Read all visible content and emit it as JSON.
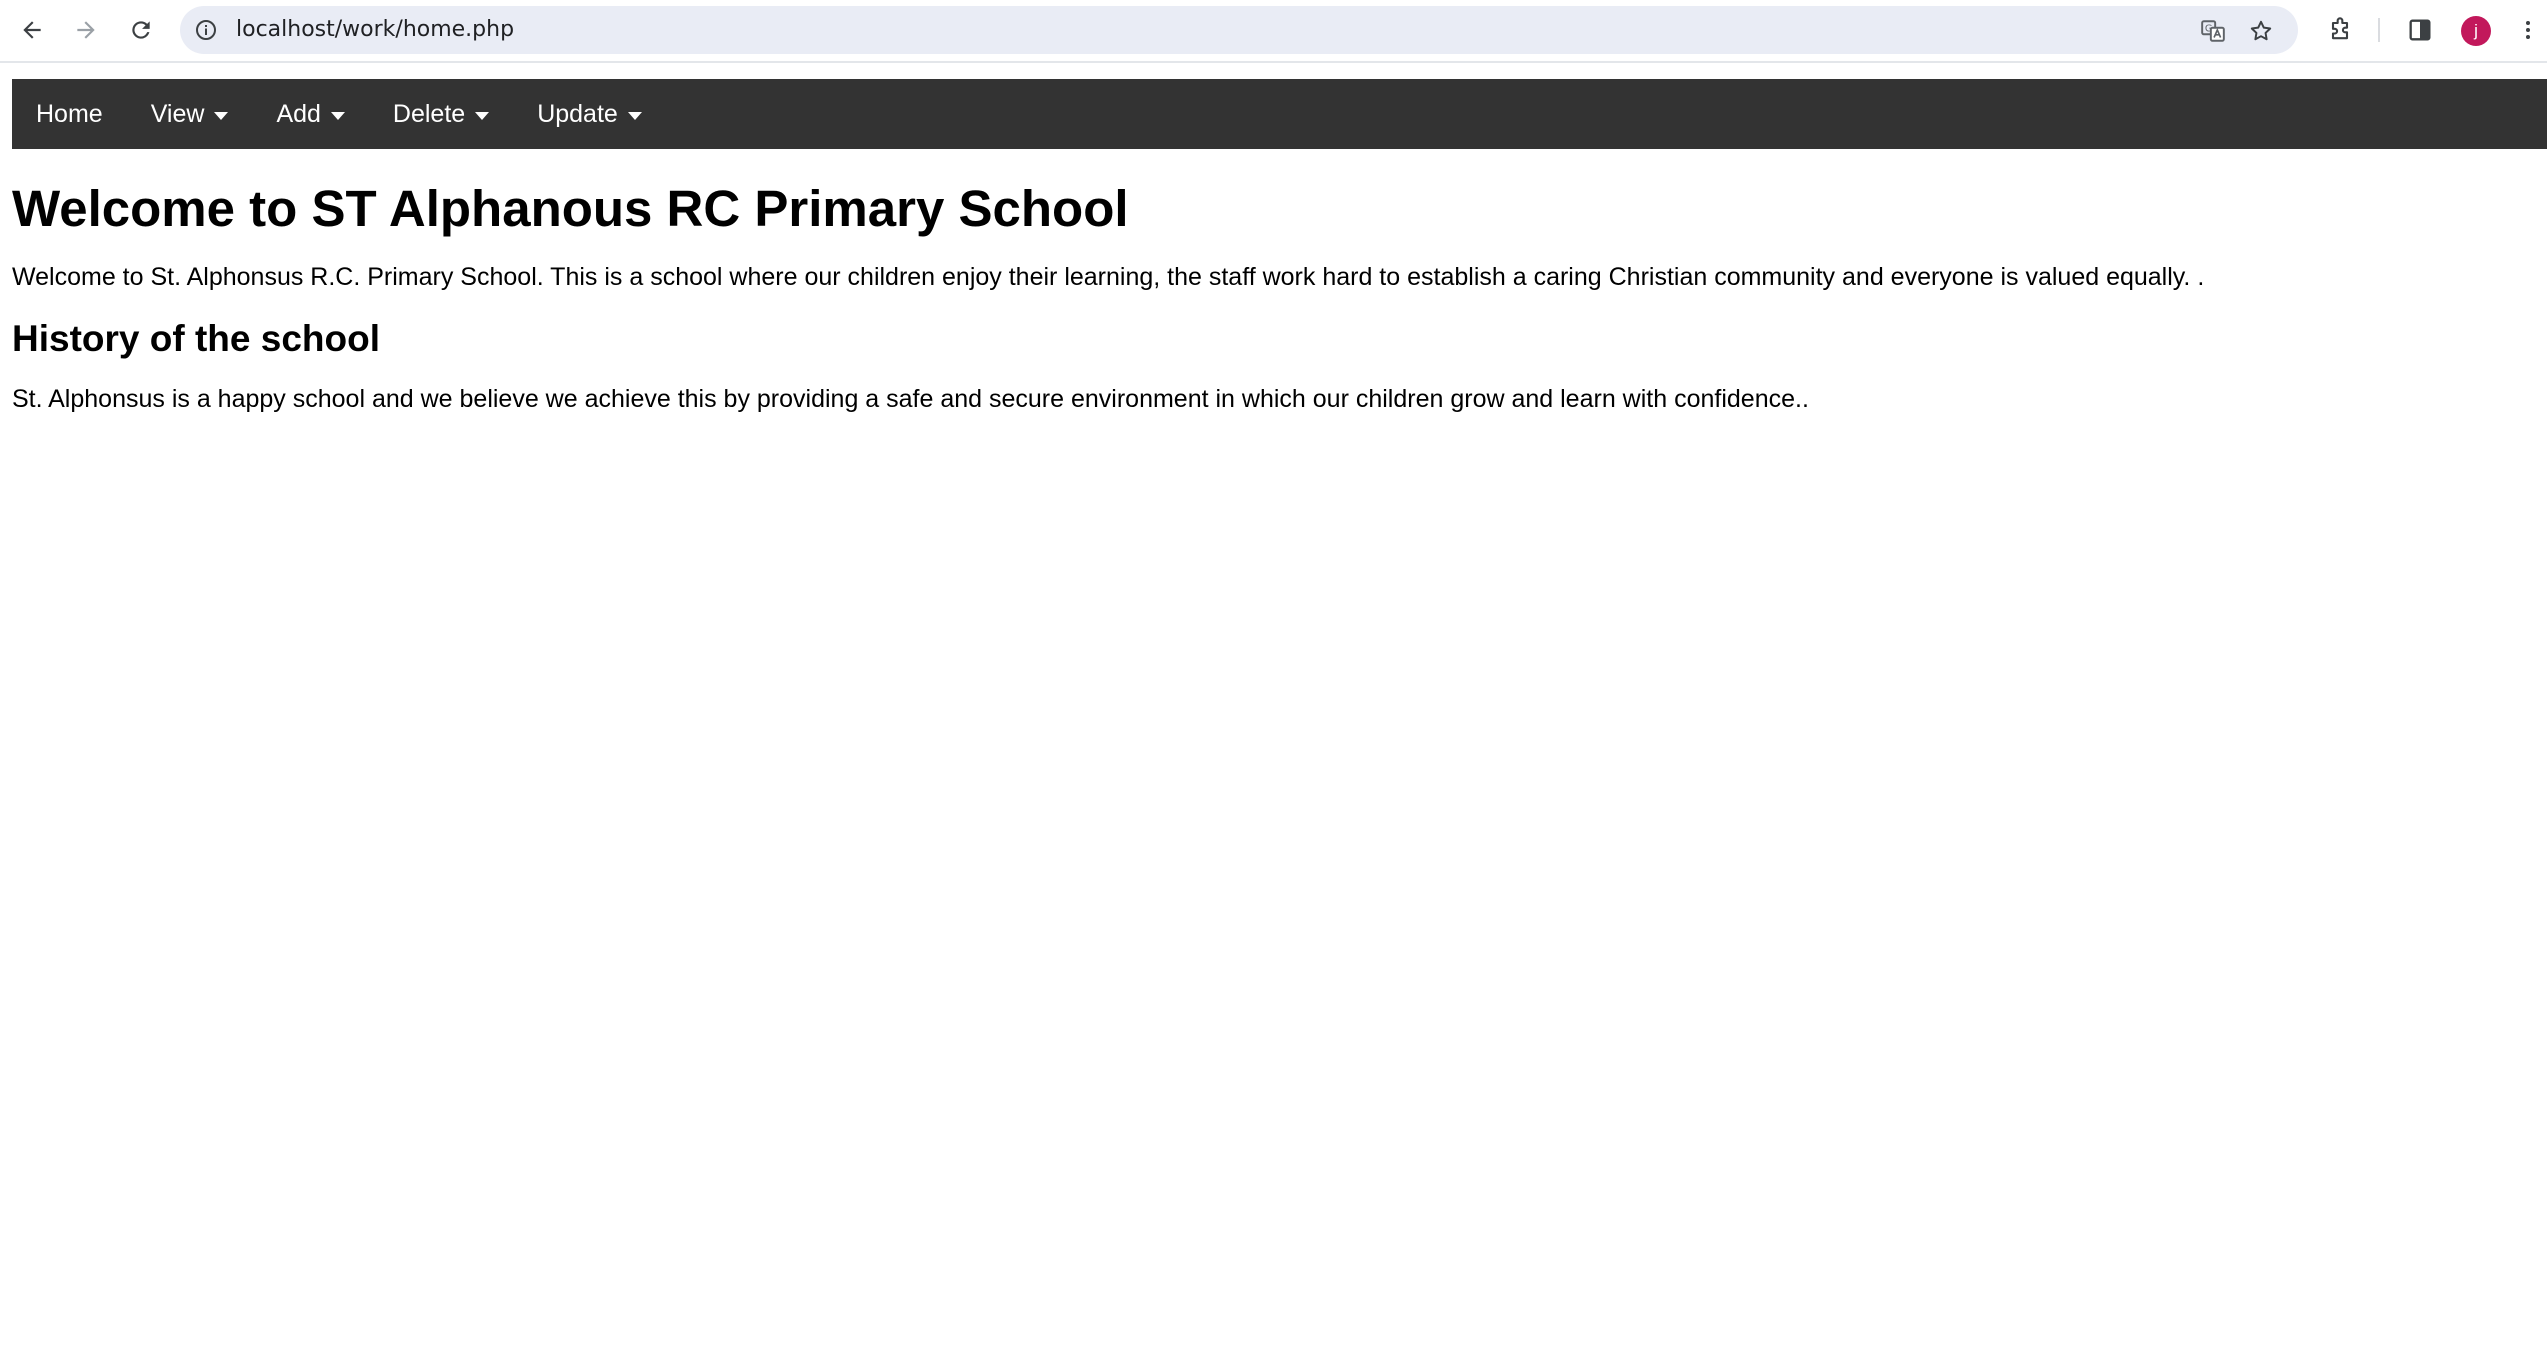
{
  "browser": {
    "url": "localhost/work/home.php",
    "profile_initial": "j",
    "icons": {
      "back": "arrow-left-icon",
      "forward": "arrow-right-icon",
      "reload": "reload-icon",
      "site_info": "info-icon",
      "translate": "translate-icon",
      "bookmark": "star-icon",
      "extensions": "puzzle-icon",
      "side_panel": "side-panel-icon",
      "menu": "kebab-menu-icon"
    },
    "colors": {
      "omnibox_bg": "#e9ecf5",
      "avatar_bg": "#c2185b"
    }
  },
  "nav": {
    "background": "#333333",
    "items": [
      {
        "label": "Home",
        "dropdown": false
      },
      {
        "label": "View",
        "dropdown": true
      },
      {
        "label": "Add",
        "dropdown": true
      },
      {
        "label": "Delete",
        "dropdown": true
      },
      {
        "label": "Update",
        "dropdown": true
      }
    ]
  },
  "main": {
    "title": "Welcome to ST Alphanous RC Primary School",
    "intro": "Welcome to St. Alphonsus R.C. Primary School. This is a school where our children enjoy their learning, the staff work hard to establish a caring Christian community and everyone is valued equally. .",
    "history_heading": "History of the school",
    "history_text": "St. Alphonsus is a happy school and we believe we achieve this by providing a safe and secure environment in which our children grow and learn with confidence.."
  }
}
